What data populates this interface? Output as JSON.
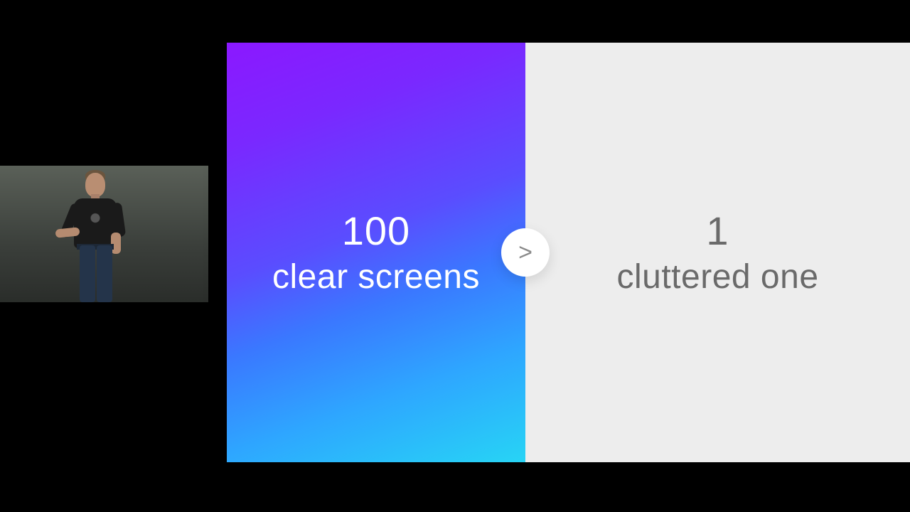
{
  "slide": {
    "left": {
      "num": "100",
      "text": "clear screens"
    },
    "right": {
      "num": "1",
      "text": "cluttered one"
    },
    "comparator": ">"
  }
}
